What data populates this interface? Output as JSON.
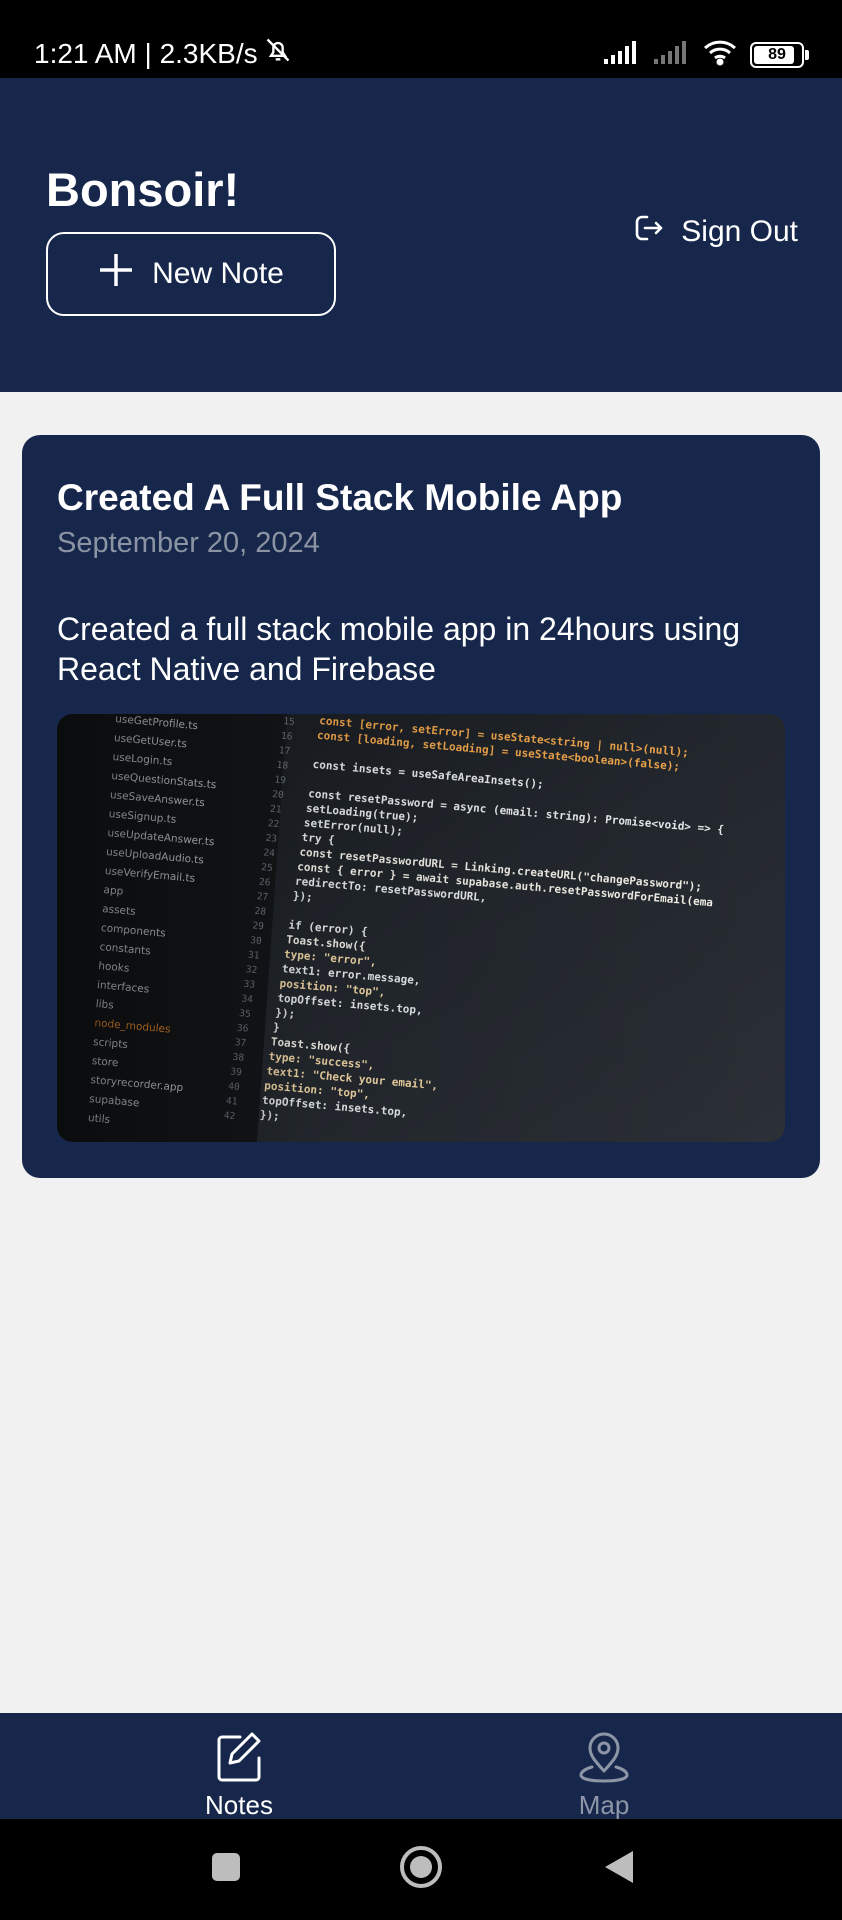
{
  "status_bar": {
    "time_speed": "1:21 AM | 2.3KB/s",
    "battery": "89",
    "icons": [
      "bell-off-icon",
      "signal-icon",
      "signal-icon",
      "wifi-icon",
      "battery-icon"
    ]
  },
  "header": {
    "greeting": "Bonsoir!",
    "new_note_label": "New Note",
    "sign_out_label": "Sign Out",
    "background_color": "#16274b"
  },
  "notes": [
    {
      "title": "Created A Full Stack Mobile App",
      "date": "September 20, 2024",
      "body": "Created a full stack mobile app in 24hours using React Native and Firebase",
      "image": {
        "file_tree": [
          "useGetProfile.ts",
          "useGetUser.ts",
          "useLogin.ts",
          "useQuestionStats.ts",
          "useSaveAnswer.ts",
          "useSignup.ts",
          "useUpdateAnswer.ts",
          "useUploadAudio.ts",
          "useVerifyEmail.ts",
          "app",
          "assets",
          "components",
          "constants",
          "hooks",
          "interfaces",
          "libs",
          "node_modules",
          "scripts",
          "store",
          "storyrecorder.app",
          "supabase",
          "utils"
        ],
        "line_numbers": [
          "15",
          "16",
          "17",
          "18",
          "19",
          "20",
          "21",
          "22",
          "23",
          "24",
          "25",
          "26",
          "27",
          "28",
          "29",
          "30",
          "31",
          "32",
          "33",
          "34",
          "35",
          "36",
          "37",
          "38",
          "39",
          "40",
          "41",
          "42"
        ],
        "code_lines": [
          "const [error, setError] = useState<string | null>(null);",
          "const [loading, setLoading] = useState<boolean>(false);",
          "",
          "const insets = useSafeAreaInsets();",
          "",
          "const resetPassword = async (email: string): Promise<void> => {",
          "  setLoading(true);",
          "  setError(null);",
          "  try {",
          "    const resetPasswordURL = Linking.createURL(\"changePassword\");",
          "    const { error } = await supabase.auth.resetPasswordForEmail(ema",
          "      redirectTo: resetPasswordURL,",
          "    });",
          "",
          "    if (error) {",
          "      Toast.show({",
          "        type: \"error\",",
          "        text1: error.message,",
          "        position: \"top\",",
          "        topOffset: insets.top,",
          "      });",
          "    }",
          "    Toast.show({",
          "      type: \"success\",",
          "      text1: \"Check your email\",",
          "      position: \"top\",",
          "      topOffset: insets.top,",
          "    });"
        ]
      }
    }
  ],
  "bottom_nav": {
    "tabs": [
      {
        "label": "Notes",
        "icon": "edit-note-icon",
        "active": true
      },
      {
        "label": "Map",
        "icon": "map-pin-icon",
        "active": false
      }
    ]
  },
  "system_nav": [
    "square-button",
    "home-button",
    "back-button"
  ]
}
